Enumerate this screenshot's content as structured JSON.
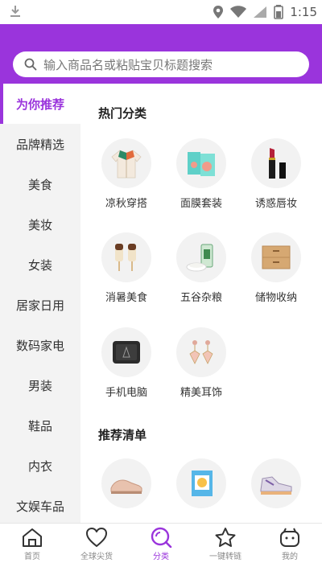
{
  "status_bar": {
    "time": "1:15"
  },
  "search": {
    "placeholder": "输入商品名或粘贴宝贝标题搜索"
  },
  "sidebar": {
    "items": [
      {
        "label": "为你推荐",
        "active": true
      },
      {
        "label": "品牌精选"
      },
      {
        "label": "美食"
      },
      {
        "label": "美妆"
      },
      {
        "label": "女装"
      },
      {
        "label": "居家日用"
      },
      {
        "label": "数码家电"
      },
      {
        "label": "男装"
      },
      {
        "label": "鞋品"
      },
      {
        "label": "内衣"
      },
      {
        "label": "文娱车品"
      }
    ]
  },
  "main": {
    "hot_title": "热门分类",
    "hot_categories": [
      {
        "label": "凉秋穿搭",
        "icon": "jacket-icon"
      },
      {
        "label": "面膜套装",
        "icon": "face-mask-box-icon"
      },
      {
        "label": "诱惑唇妆",
        "icon": "lipstick-icon"
      },
      {
        "label": "消暑美食",
        "icon": "popsicle-icon"
      },
      {
        "label": "五谷杂粮",
        "icon": "rice-bag-icon"
      },
      {
        "label": "储物收纳",
        "icon": "drawer-icon"
      },
      {
        "label": "手机电脑",
        "icon": "phone-icon"
      },
      {
        "label": "精美耳饰",
        "icon": "earrings-icon"
      }
    ],
    "rec_title": "推荐清单",
    "rec_items": [
      {
        "icon": "loafer-shoe-icon"
      },
      {
        "icon": "mask-pack-icon"
      },
      {
        "icon": "sneaker-icon"
      }
    ]
  },
  "bottom_nav": {
    "items": [
      {
        "label": "首页",
        "icon": "home-icon"
      },
      {
        "label": "全球尖货",
        "icon": "heart-icon"
      },
      {
        "label": "分类",
        "icon": "search-category-icon",
        "active": true
      },
      {
        "label": "一键转链",
        "icon": "star-icon"
      },
      {
        "label": "我的",
        "icon": "profile-icon"
      }
    ]
  },
  "colors": {
    "accent": "#9a34dc",
    "sidebar_bg": "#f3f3f3"
  }
}
